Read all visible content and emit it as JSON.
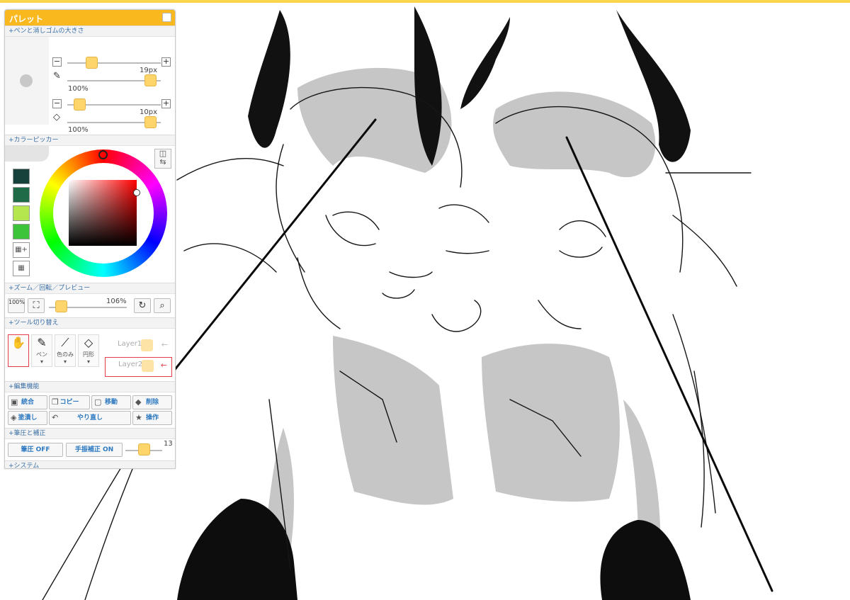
{
  "palette": {
    "title": "パレット",
    "sections": {
      "pen_size": "+ペンと消しゴムの大きさ",
      "color_picker": "+カラーピッカー",
      "zoom": "+ズーム／回転／プレビュー",
      "tool_switch": "+ツール切り替え",
      "edit": "+編集機能",
      "pressure": "+筆圧と補正",
      "system": "+システム"
    },
    "pen": {
      "size": "19px",
      "opacity": "100%",
      "size_fraction": 0.3,
      "opacity_fraction": 1.0
    },
    "eraser": {
      "size": "10px",
      "opacity": "100%",
      "size_fraction": 0.1,
      "opacity_fraction": 1.0
    },
    "color_swatches": [
      "#17413b",
      "#1f6b47",
      "#b6e64e",
      "#3ec43a"
    ],
    "current_color": "#ff0000",
    "zoom": {
      "button_100": "100%",
      "value": "106%"
    },
    "tools": [
      {
        "name": "hand",
        "label": "",
        "icon": "hand-icon",
        "active": true
      },
      {
        "name": "pen",
        "label": "ペン",
        "icon": "pen-icon",
        "active": false
      },
      {
        "name": "color",
        "label": "色のみ",
        "icon": "dropper-icon",
        "active": false
      },
      {
        "name": "eraser",
        "label": "円形",
        "icon": "eraser-icon",
        "active": false
      }
    ],
    "layers": [
      {
        "label": "Layer1",
        "selected": false
      },
      {
        "label": "Layer2",
        "selected": true
      }
    ],
    "edit": {
      "merge": "統合",
      "copy": "コピー",
      "move": "移動",
      "delete": "削除",
      "fill": "塗潰し",
      "redo": "やり直し",
      "operation": "操作"
    },
    "pressure": {
      "pen_pressure": "筆圧 OFF",
      "stabilizer": "手振補正 ON",
      "stabilizer_value": "13"
    }
  },
  "colors": {
    "accent": "#f8b81e",
    "topbar": "#f8d54a",
    "section_text": "#3a6fa5",
    "button_text": "#2b78c0",
    "active_border": "#e53d4a"
  }
}
